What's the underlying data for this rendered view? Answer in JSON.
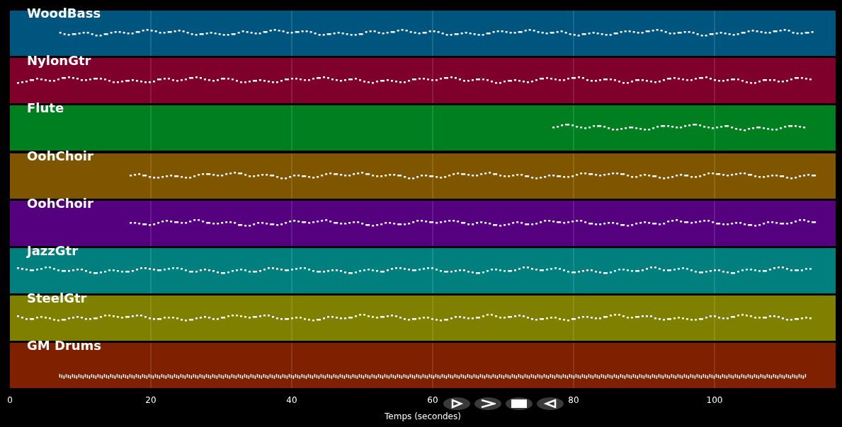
{
  "tracks": [
    {
      "name": "WoodBass",
      "color": "#00557f"
    },
    {
      "name": "NylonGtr",
      "color": "#7f002a"
    },
    {
      "name": "Flute",
      "color": "#007f20"
    },
    {
      "name": "OohChoir",
      "color": "#7f5500"
    },
    {
      "name": "OohChoir",
      "color": "#55007f"
    },
    {
      "name": "JazzGtr",
      "color": "#007f7f"
    },
    {
      "name": "SteelGtr",
      "color": "#7f7f00"
    },
    {
      "name": "GM Drums",
      "color": "#7f2000"
    }
  ],
  "axis": {
    "ticks": [
      "0",
      "20",
      "40",
      "60",
      "80",
      "100"
    ],
    "label": "Temps (secondes)"
  },
  "controls": [
    {
      "kind": "play"
    },
    {
      "kind": "forward"
    },
    {
      "kind": "stop"
    },
    {
      "kind": "back"
    }
  ]
}
